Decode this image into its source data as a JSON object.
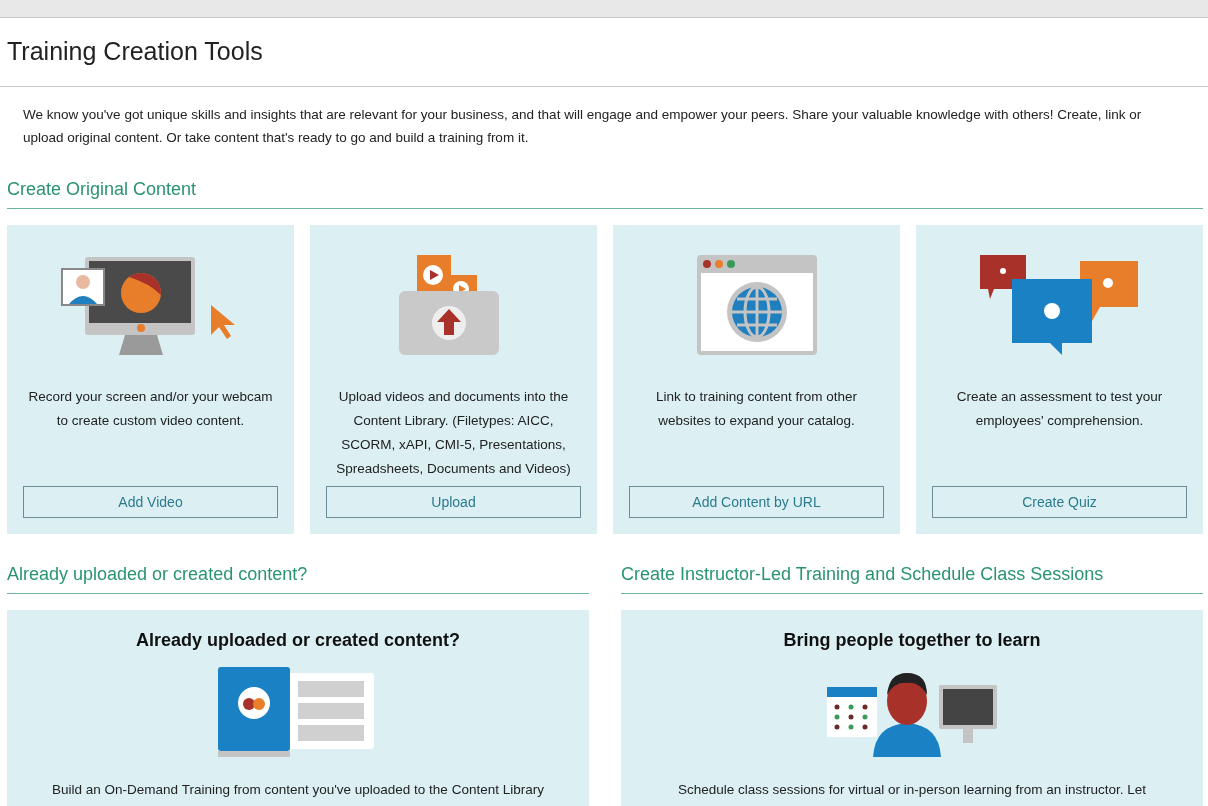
{
  "header": {
    "title": "Training Creation Tools"
  },
  "intro": "We know you've got unique skills and insights that are relevant for your business, and that will engage and empower your peers. Share your valuable knowledge with others! Create, link or upload original content. Or take content that's ready to go and build a training from it.",
  "create_original": {
    "heading": "Create Original Content",
    "cards": [
      {
        "kind": "video",
        "description": "Record your screen and/or your webcam to create custom video content.",
        "button": "Add Video"
      },
      {
        "kind": "upload",
        "description": "Upload videos and documents into the Content Library. (Filetypes: AICC, SCORM, xAPI, CMI-5, Presentations, Spreadsheets, Documents and Videos)",
        "button": "Upload"
      },
      {
        "kind": "url",
        "description": "Link to training content from other websites to expand your catalog.",
        "button": "Add Content by URL"
      },
      {
        "kind": "quiz",
        "description": "Create an assessment to test your employees' comprehension.",
        "button": "Create Quiz"
      }
    ]
  },
  "lower_sections": [
    {
      "kind": "library",
      "heading": "Already uploaded or created content?",
      "card_title": "Already uploaded or created content?",
      "description": "Build an On-Demand Training from content you've uploaded to the Content Library"
    },
    {
      "kind": "instructor",
      "heading": "Create Instructor-Led Training and Schedule Class Sessions",
      "card_title": "Bring people together to learn",
      "description": "Schedule class sessions for virtual or in-person learning from an instructor. Let"
    }
  ]
}
